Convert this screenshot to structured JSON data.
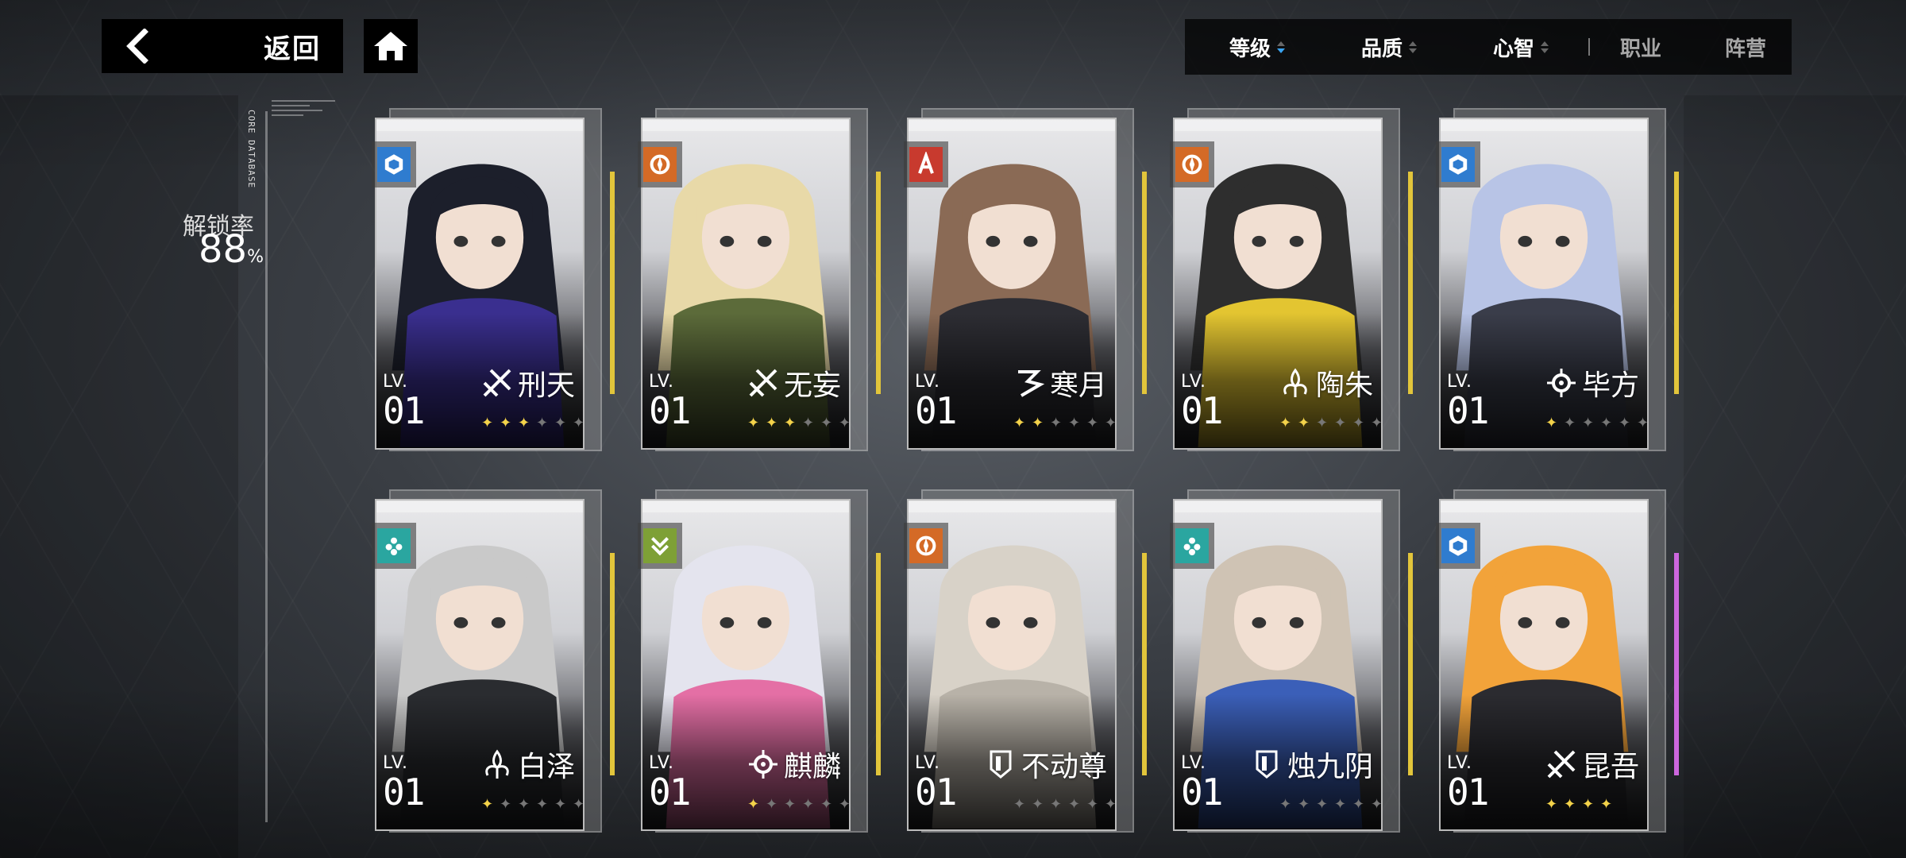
{
  "nav": {
    "back_label": "返回",
    "back_icon": "chevron-left-icon",
    "home_icon": "home-icon"
  },
  "sort": {
    "items": [
      {
        "label": "等级",
        "active": true
      },
      {
        "label": "品质"
      },
      {
        "label": "心智"
      },
      {
        "label": "职业"
      },
      {
        "label": "阵营"
      }
    ],
    "active_color": "#39a4f2"
  },
  "side": {
    "vertical_text": "CORE DATABASE",
    "unlock_label": "解锁率",
    "unlock_value": "88",
    "unlock_unit": "%"
  },
  "colors": {
    "gold_accent": "#e2c53b",
    "purple_accent": "#cc66dd",
    "element_blue": "#2f7ccf",
    "element_orange": "#d46a26",
    "element_red": "#c83a2e",
    "element_teal": "#2aa6a0",
    "element_green": "#7ea036"
  },
  "cards": [
    {
      "name": "刑天",
      "lv_label": "LV.",
      "lv": "01",
      "element": "blue",
      "stars": 3,
      "max_stars": 6,
      "accent": "gold",
      "class_icon": "blade-icon",
      "hair": "#1c1f2b",
      "cloth": "#3a2f8f"
    },
    {
      "name": "无妄",
      "lv_label": "LV.",
      "lv": "01",
      "element": "orange",
      "stars": 3,
      "max_stars": 6,
      "accent": "gold",
      "class_icon": "blade-icon",
      "hair": "#e8d9a8",
      "cloth": "#5c6b3a"
    },
    {
      "name": "寒月",
      "lv_label": "LV.",
      "lv": "01",
      "element": "red",
      "stars": 2,
      "max_stars": 6,
      "accent": "gold",
      "class_icon": "spiral-icon",
      "hair": "#8a6a55",
      "cloth": "#2d2d33"
    },
    {
      "name": "陶朱",
      "lv_label": "LV.",
      "lv": "01",
      "element": "orange",
      "stars": 2,
      "max_stars": 6,
      "accent": "gold",
      "class_icon": "lily-icon",
      "hair": "#2e2e2e",
      "cloth": "#e3c531"
    },
    {
      "name": "毕方",
      "lv_label": "LV.",
      "lv": "01",
      "element": "blue",
      "stars": 1,
      "max_stars": 6,
      "accent": "gold",
      "class_icon": "crosshair-icon",
      "hair": "#b8c4e6",
      "cloth": "#3a3d4a"
    },
    {
      "name": "白泽",
      "lv_label": "LV.",
      "lv": "01",
      "element": "teal",
      "stars": 1,
      "max_stars": 6,
      "accent": "gold",
      "class_icon": "lily-icon",
      "hair": "#c9c9c9",
      "cloth": "#2a2c30"
    },
    {
      "name": "麒麟",
      "lv_label": "LV.",
      "lv": "01",
      "element": "green",
      "stars": 1,
      "max_stars": 6,
      "accent": "gold",
      "class_icon": "crosshair-icon",
      "hair": "#e4e4ee",
      "cloth": "#e46fa5"
    },
    {
      "name": "不动尊",
      "lv_label": "LV.",
      "lv": "01",
      "element": "orange",
      "stars": 0,
      "max_stars": 6,
      "accent": "gold",
      "class_icon": "shield-icon",
      "hair": "#d8d2c8",
      "cloth": "#b8b2a8"
    },
    {
      "name": "烛九阴",
      "lv_label": "LV.",
      "lv": "01",
      "element": "teal",
      "stars": 0,
      "max_stars": 6,
      "accent": "gold",
      "class_icon": "shield-icon",
      "hair": "#cfc3b4",
      "cloth": "#3b5fb8"
    },
    {
      "name": "昆吾",
      "lv_label": "LV.",
      "lv": "01",
      "element": "blue",
      "stars": 4,
      "max_stars": 4,
      "accent": "purple",
      "class_icon": "blade-icon",
      "hair": "#f2a33a",
      "cloth": "#2b2b30"
    }
  ]
}
